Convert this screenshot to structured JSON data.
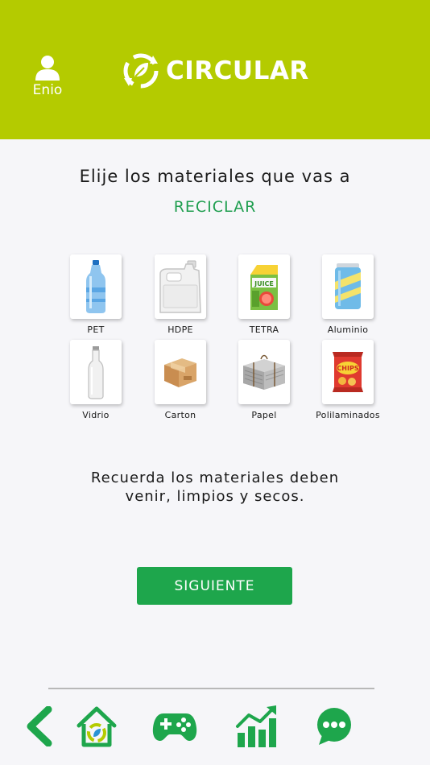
{
  "header": {
    "user_name": "Enio",
    "brand": "CIRCULAR",
    "bg_color": "#b4cb00"
  },
  "prompt": {
    "line1": "Elije los materiales que vas a",
    "line2": "RECICLAR"
  },
  "materials": [
    {
      "label": "PET",
      "icon": "plastic-bottle-icon"
    },
    {
      "label": "HDPE",
      "icon": "jug-container-icon"
    },
    {
      "label": "TETRA",
      "icon": "juice-carton-icon"
    },
    {
      "label": "Aluminio",
      "icon": "soda-can-icon"
    },
    {
      "label": "Vidrio",
      "icon": "glass-bottle-icon"
    },
    {
      "label": "Carton",
      "icon": "cardboard-box-icon"
    },
    {
      "label": "Papel",
      "icon": "newspaper-bundle-icon"
    },
    {
      "label": "Polilaminados",
      "icon": "chips-bag-icon"
    }
  ],
  "tetra_art": {
    "brand": "JUICE"
  },
  "chips_art": {
    "brand": "CHIPS"
  },
  "reminder": {
    "line1": "Recuerda los materiales deben",
    "line2": "venir, limpios y secos."
  },
  "next_button": {
    "label": "SIGUIENTE",
    "color": "#1ea64c"
  },
  "accent_text_color": "#1f9e4f",
  "nav": [
    {
      "name": "back",
      "icon": "chevron-left-icon"
    },
    {
      "name": "home",
      "icon": "recycle-home-icon"
    },
    {
      "name": "games",
      "icon": "gamepad-icon"
    },
    {
      "name": "stats",
      "icon": "growth-chart-icon"
    },
    {
      "name": "chat",
      "icon": "chat-bubble-icon"
    }
  ]
}
